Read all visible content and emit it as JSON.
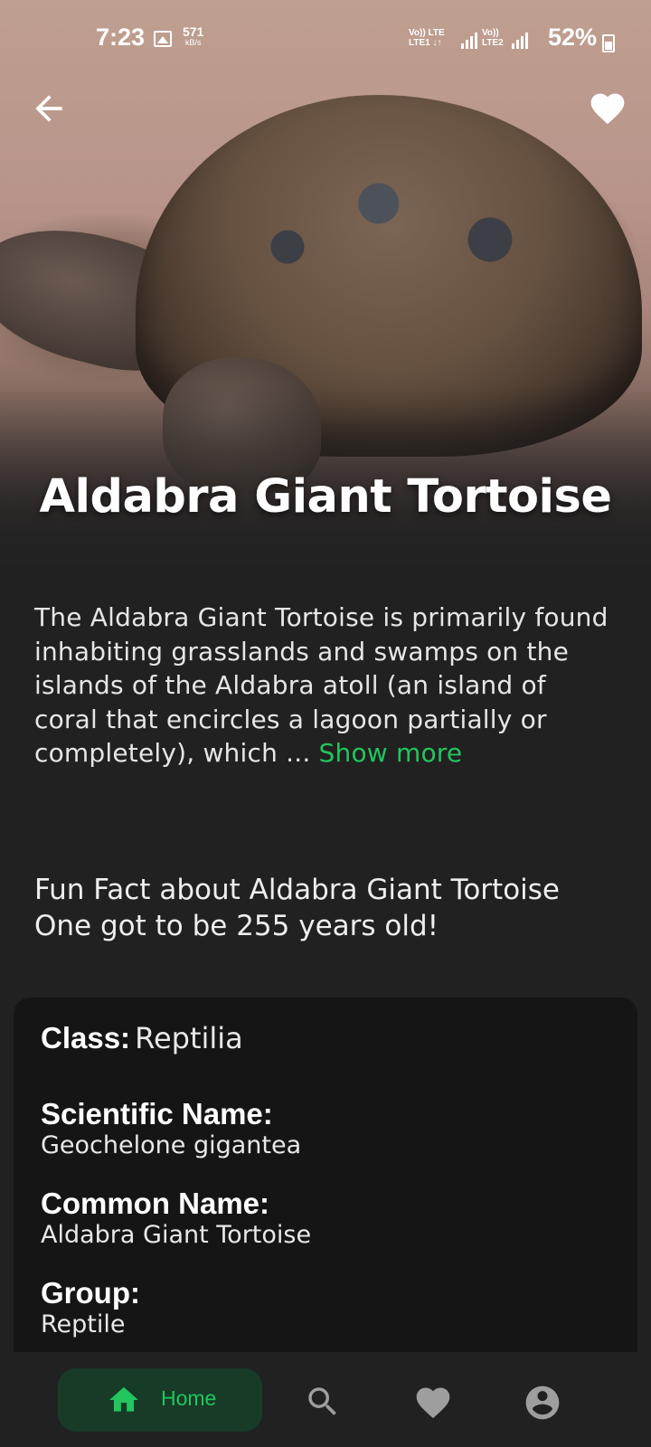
{
  "status_bar": {
    "time": "7:23",
    "speed_value": "571",
    "speed_unit": "kB/s",
    "net1": "Vo)) LTE",
    "net1b": "LTE1 ↓↑",
    "net2": "Vo))",
    "net2b": "LTE2",
    "battery": "52%"
  },
  "hero": {
    "title": "Aldabra Giant Tortoise",
    "back_icon": "arrow-left-icon",
    "favorite_icon": "heart-icon"
  },
  "description": {
    "text": "The Aldabra Giant Tortoise is primarily found inhabiting grasslands and swamps on the islands of the Aldabra atoll (an island of coral that encircles a lagoon partially or completely), which ... ",
    "more": "Show more"
  },
  "fun_fact": {
    "heading": "Fun Fact about Aldabra Giant Tortoise",
    "text": "One got to be 255 years old!"
  },
  "info": {
    "class_label": "Class:",
    "class_value": "Reptilia",
    "scientific_label": "Scientific Name:",
    "scientific_value": "Geochelone gigantea",
    "common_label": "Common Name:",
    "common_value": "Aldabra Giant Tortoise",
    "group_label": "Group:",
    "group_value": "Reptile"
  },
  "nav": {
    "home_label": "Home",
    "items": [
      "home-icon",
      "search-icon",
      "heart-icon",
      "account-icon"
    ]
  },
  "colors": {
    "accent": "#22c55e",
    "background": "#212121",
    "card": "#151515"
  }
}
